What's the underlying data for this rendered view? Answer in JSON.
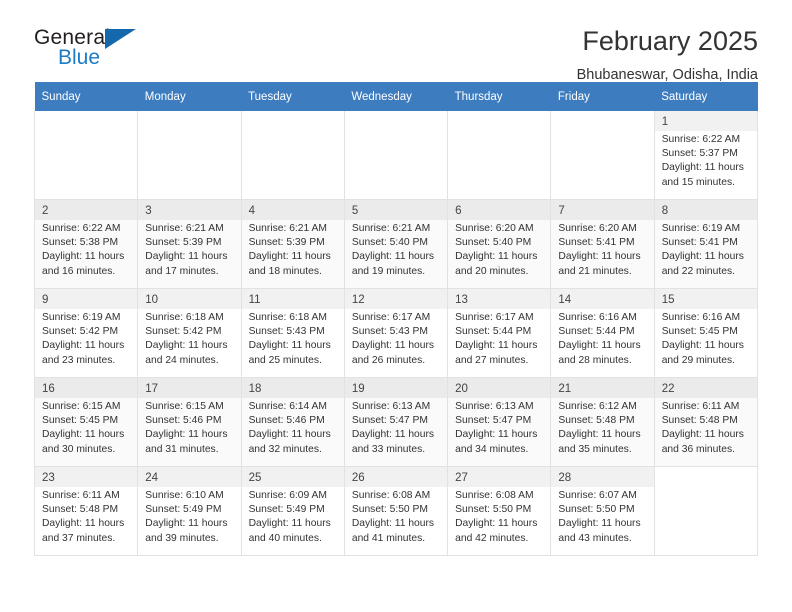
{
  "logo": {
    "word_top": "General",
    "word_bottom": "Blue",
    "triangle_color": "#1668ad",
    "blue_color": "#1d7cc4"
  },
  "header": {
    "title": "February 2025",
    "subtitle": "Bhubaneswar, Odisha, India",
    "header_bg": "#3d7cbf"
  },
  "weekdays": [
    "Sunday",
    "Monday",
    "Tuesday",
    "Wednesday",
    "Thursday",
    "Friday",
    "Saturday"
  ],
  "weeks": [
    [
      {
        "day": "",
        "sunrise": "",
        "sunset": "",
        "daylight_line1": "",
        "daylight_line2": ""
      },
      {
        "day": "",
        "sunrise": "",
        "sunset": "",
        "daylight_line1": "",
        "daylight_line2": ""
      },
      {
        "day": "",
        "sunrise": "",
        "sunset": "",
        "daylight_line1": "",
        "daylight_line2": ""
      },
      {
        "day": "",
        "sunrise": "",
        "sunset": "",
        "daylight_line1": "",
        "daylight_line2": ""
      },
      {
        "day": "",
        "sunrise": "",
        "sunset": "",
        "daylight_line1": "",
        "daylight_line2": ""
      },
      {
        "day": "",
        "sunrise": "",
        "sunset": "",
        "daylight_line1": "",
        "daylight_line2": ""
      },
      {
        "day": "1",
        "sunrise": "Sunrise: 6:22 AM",
        "sunset": "Sunset: 5:37 PM",
        "daylight_line1": "Daylight: 11 hours",
        "daylight_line2": "and 15 minutes."
      }
    ],
    [
      {
        "day": "2",
        "sunrise": "Sunrise: 6:22 AM",
        "sunset": "Sunset: 5:38 PM",
        "daylight_line1": "Daylight: 11 hours",
        "daylight_line2": "and 16 minutes."
      },
      {
        "day": "3",
        "sunrise": "Sunrise: 6:21 AM",
        "sunset": "Sunset: 5:39 PM",
        "daylight_line1": "Daylight: 11 hours",
        "daylight_line2": "and 17 minutes."
      },
      {
        "day": "4",
        "sunrise": "Sunrise: 6:21 AM",
        "sunset": "Sunset: 5:39 PM",
        "daylight_line1": "Daylight: 11 hours",
        "daylight_line2": "and 18 minutes."
      },
      {
        "day": "5",
        "sunrise": "Sunrise: 6:21 AM",
        "sunset": "Sunset: 5:40 PM",
        "daylight_line1": "Daylight: 11 hours",
        "daylight_line2": "and 19 minutes."
      },
      {
        "day": "6",
        "sunrise": "Sunrise: 6:20 AM",
        "sunset": "Sunset: 5:40 PM",
        "daylight_line1": "Daylight: 11 hours",
        "daylight_line2": "and 20 minutes."
      },
      {
        "day": "7",
        "sunrise": "Sunrise: 6:20 AM",
        "sunset": "Sunset: 5:41 PM",
        "daylight_line1": "Daylight: 11 hours",
        "daylight_line2": "and 21 minutes."
      },
      {
        "day": "8",
        "sunrise": "Sunrise: 6:19 AM",
        "sunset": "Sunset: 5:41 PM",
        "daylight_line1": "Daylight: 11 hours",
        "daylight_line2": "and 22 minutes."
      }
    ],
    [
      {
        "day": "9",
        "sunrise": "Sunrise: 6:19 AM",
        "sunset": "Sunset: 5:42 PM",
        "daylight_line1": "Daylight: 11 hours",
        "daylight_line2": "and 23 minutes."
      },
      {
        "day": "10",
        "sunrise": "Sunrise: 6:18 AM",
        "sunset": "Sunset: 5:42 PM",
        "daylight_line1": "Daylight: 11 hours",
        "daylight_line2": "and 24 minutes."
      },
      {
        "day": "11",
        "sunrise": "Sunrise: 6:18 AM",
        "sunset": "Sunset: 5:43 PM",
        "daylight_line1": "Daylight: 11 hours",
        "daylight_line2": "and 25 minutes."
      },
      {
        "day": "12",
        "sunrise": "Sunrise: 6:17 AM",
        "sunset": "Sunset: 5:43 PM",
        "daylight_line1": "Daylight: 11 hours",
        "daylight_line2": "and 26 minutes."
      },
      {
        "day": "13",
        "sunrise": "Sunrise: 6:17 AM",
        "sunset": "Sunset: 5:44 PM",
        "daylight_line1": "Daylight: 11 hours",
        "daylight_line2": "and 27 minutes."
      },
      {
        "day": "14",
        "sunrise": "Sunrise: 6:16 AM",
        "sunset": "Sunset: 5:44 PM",
        "daylight_line1": "Daylight: 11 hours",
        "daylight_line2": "and 28 minutes."
      },
      {
        "day": "15",
        "sunrise": "Sunrise: 6:16 AM",
        "sunset": "Sunset: 5:45 PM",
        "daylight_line1": "Daylight: 11 hours",
        "daylight_line2": "and 29 minutes."
      }
    ],
    [
      {
        "day": "16",
        "sunrise": "Sunrise: 6:15 AM",
        "sunset": "Sunset: 5:45 PM",
        "daylight_line1": "Daylight: 11 hours",
        "daylight_line2": "and 30 minutes."
      },
      {
        "day": "17",
        "sunrise": "Sunrise: 6:15 AM",
        "sunset": "Sunset: 5:46 PM",
        "daylight_line1": "Daylight: 11 hours",
        "daylight_line2": "and 31 minutes."
      },
      {
        "day": "18",
        "sunrise": "Sunrise: 6:14 AM",
        "sunset": "Sunset: 5:46 PM",
        "daylight_line1": "Daylight: 11 hours",
        "daylight_line2": "and 32 minutes."
      },
      {
        "day": "19",
        "sunrise": "Sunrise: 6:13 AM",
        "sunset": "Sunset: 5:47 PM",
        "daylight_line1": "Daylight: 11 hours",
        "daylight_line2": "and 33 minutes."
      },
      {
        "day": "20",
        "sunrise": "Sunrise: 6:13 AM",
        "sunset": "Sunset: 5:47 PM",
        "daylight_line1": "Daylight: 11 hours",
        "daylight_line2": "and 34 minutes."
      },
      {
        "day": "21",
        "sunrise": "Sunrise: 6:12 AM",
        "sunset": "Sunset: 5:48 PM",
        "daylight_line1": "Daylight: 11 hours",
        "daylight_line2": "and 35 minutes."
      },
      {
        "day": "22",
        "sunrise": "Sunrise: 6:11 AM",
        "sunset": "Sunset: 5:48 PM",
        "daylight_line1": "Daylight: 11 hours",
        "daylight_line2": "and 36 minutes."
      }
    ],
    [
      {
        "day": "23",
        "sunrise": "Sunrise: 6:11 AM",
        "sunset": "Sunset: 5:48 PM",
        "daylight_line1": "Daylight: 11 hours",
        "daylight_line2": "and 37 minutes."
      },
      {
        "day": "24",
        "sunrise": "Sunrise: 6:10 AM",
        "sunset": "Sunset: 5:49 PM",
        "daylight_line1": "Daylight: 11 hours",
        "daylight_line2": "and 39 minutes."
      },
      {
        "day": "25",
        "sunrise": "Sunrise: 6:09 AM",
        "sunset": "Sunset: 5:49 PM",
        "daylight_line1": "Daylight: 11 hours",
        "daylight_line2": "and 40 minutes."
      },
      {
        "day": "26",
        "sunrise": "Sunrise: 6:08 AM",
        "sunset": "Sunset: 5:50 PM",
        "daylight_line1": "Daylight: 11 hours",
        "daylight_line2": "and 41 minutes."
      },
      {
        "day": "27",
        "sunrise": "Sunrise: 6:08 AM",
        "sunset": "Sunset: 5:50 PM",
        "daylight_line1": "Daylight: 11 hours",
        "daylight_line2": "and 42 minutes."
      },
      {
        "day": "28",
        "sunrise": "Sunrise: 6:07 AM",
        "sunset": "Sunset: 5:50 PM",
        "daylight_line1": "Daylight: 11 hours",
        "daylight_line2": "and 43 minutes."
      },
      {
        "day": "",
        "sunrise": "",
        "sunset": "",
        "daylight_line1": "",
        "daylight_line2": ""
      }
    ]
  ]
}
